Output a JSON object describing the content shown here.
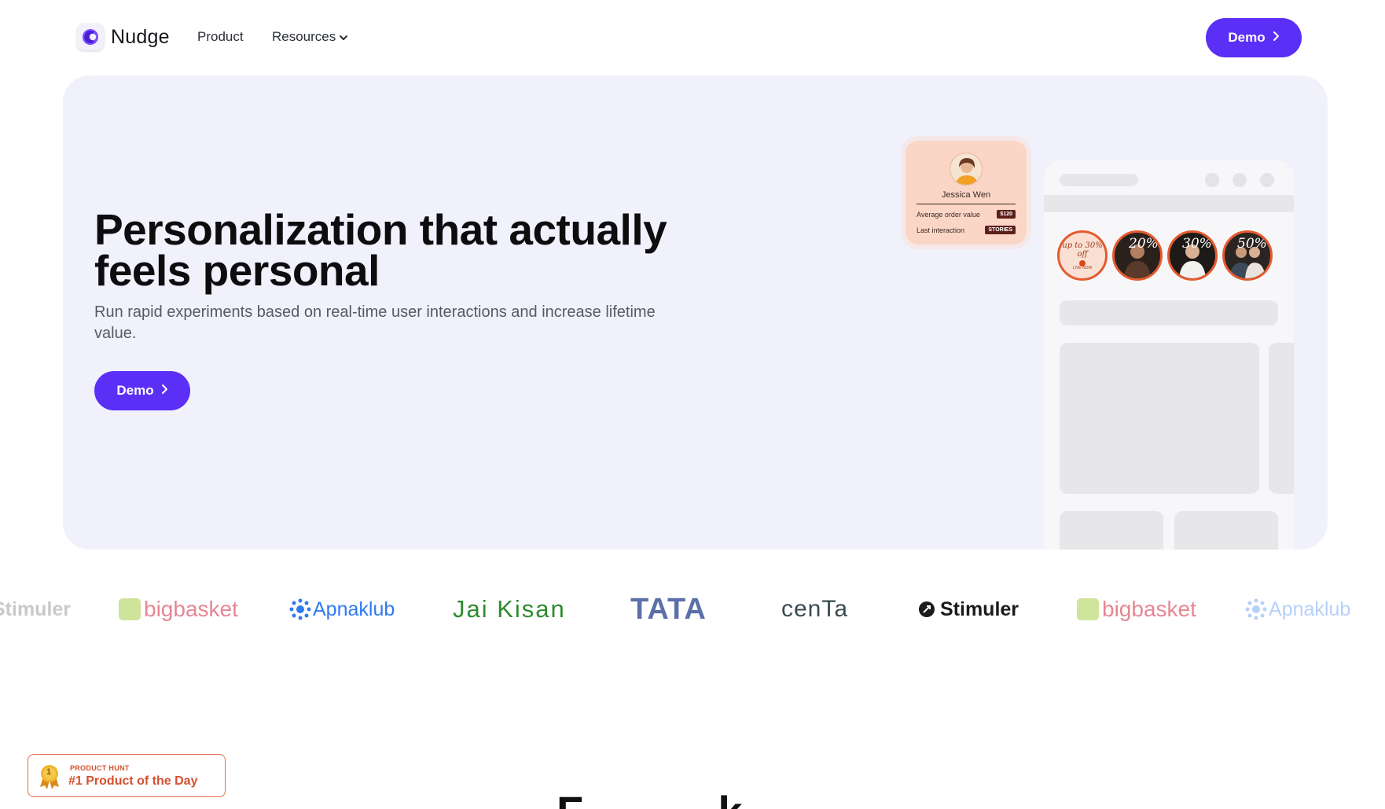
{
  "nav": {
    "brand": "Nudge",
    "links": [
      {
        "label": "Product"
      },
      {
        "label": "Resources"
      }
    ],
    "cta": "Demo"
  },
  "hero": {
    "title": "Personalization that actually feels personal",
    "subtitle": "Run rapid experiments based on real-time user interactions and increase lifetime value.",
    "cta": "Demo",
    "profile_card": {
      "name": "Jessica Wen",
      "rows": [
        {
          "label": "Average order value",
          "value": "$120"
        },
        {
          "label": "Last interaction",
          "value": "STORIES"
        }
      ]
    },
    "stories": [
      "up to 30% off",
      "20%",
      "30%",
      "50%"
    ],
    "stories_caption": "LIVE NOW"
  },
  "logos": [
    "Stimuler",
    "bigbasket",
    "Apnaklub",
    "Jai Kisan",
    "TATA",
    "cenTa",
    "Stimuler",
    "bigbasket",
    "Apnaklub"
  ],
  "badge": {
    "kicker": "PRODUCT HUNT",
    "title": "#1 Product of the Day",
    "rank": "1"
  },
  "colors": {
    "accent": "#5b2ff6",
    "hero_bg": "#f1f1fc",
    "badge": "#d4502f"
  }
}
